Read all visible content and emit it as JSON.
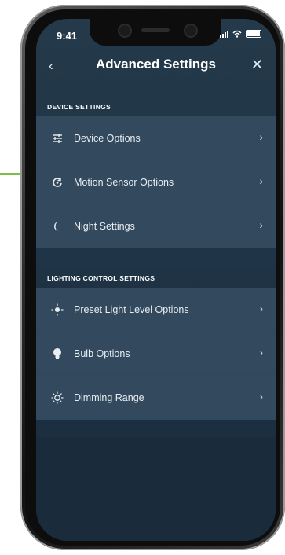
{
  "status_bar": {
    "time": "9:41"
  },
  "header": {
    "title": "Advanced Settings"
  },
  "sections": [
    {
      "heading": "DEVICE SETTINGS",
      "items": [
        {
          "label": "Device Options",
          "icon": "sliders-icon"
        },
        {
          "label": "Motion Sensor Options",
          "icon": "motion-sensor-icon"
        },
        {
          "label": "Night Settings",
          "icon": "moon-icon"
        }
      ]
    },
    {
      "heading": "LIGHTING CONTROL SETTINGS",
      "items": [
        {
          "label": "Preset Light Level Options",
          "icon": "light-level-icon"
        },
        {
          "label": "Bulb Options",
          "icon": "bulb-icon"
        },
        {
          "label": "Dimming Range",
          "icon": "sun-icon"
        }
      ]
    }
  ],
  "colors": {
    "accent": "#7bc043",
    "screen_bg": "#1f3446",
    "row_bg": "#33495d"
  }
}
